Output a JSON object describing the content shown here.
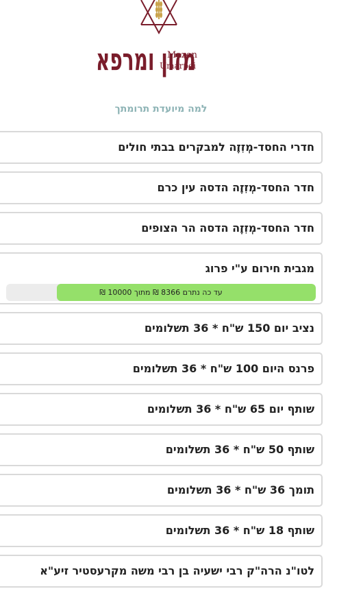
{
  "logo": {
    "hebrew_text": "מזון ומרפא",
    "latin_line1": "Mazon",
    "latin_line2": "Umarpei",
    "brand_color": "#7a1d2b",
    "accent_color": "#c9a24a"
  },
  "subtitle": "למה מיועדת תרומתך",
  "options": [
    {
      "label": "חדרי החסד-מְזִזֶה למבקרים בבתי חולים"
    },
    {
      "label": "חדר החסד-מְזִזֶה הדסה עין כרם"
    },
    {
      "label": "חדר החסד-מְזִזֶה הדסה הר הצופים"
    },
    {
      "label": "מגבית חירום ע\"י פרוג",
      "progress": {
        "text": "עד כה נתרם 8366 ₪ מתוך 10000 ₪",
        "raised": 8366,
        "goal": 10000,
        "fraction": 0.8366,
        "fill_color": "#95e06a"
      }
    },
    {
      "label": "נציב יום 150 ש\"ח * 36 תשלומים"
    },
    {
      "label": "פרנס היום 100 ש\"ח * 36 תשלומים"
    },
    {
      "label": "שותף יום 65 ש\"ח * 36 תשלומים"
    },
    {
      "label": "שותף 50 ש\"ח * 36 תשלומים"
    },
    {
      "label": "תומך 36 ש\"ח * 36 תשלומים"
    },
    {
      "label": "שותף 18 ש\"ח * 36 תשלומים"
    },
    {
      "label": "לטו\"נ הרה\"ק רבי ישעיה בן רבי משה מקרעסטיר זיע\"א"
    }
  ]
}
